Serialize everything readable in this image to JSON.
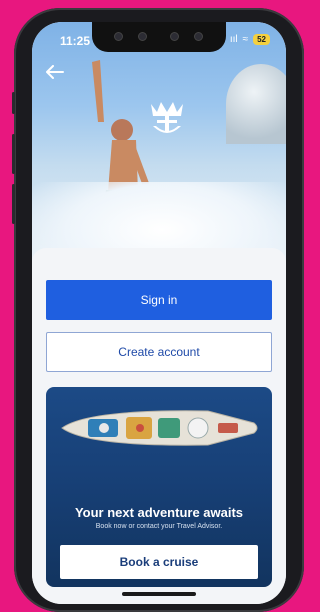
{
  "status_bar": {
    "time": "11:25",
    "signal": "ııl",
    "wifi": "≈",
    "battery": "52"
  },
  "icons": {
    "back": "back-arrow-icon",
    "logo": "royal-caribbean-crown-anchor-logo"
  },
  "auth": {
    "sign_in_label": "Sign in",
    "create_account_label": "Create account"
  },
  "promo": {
    "title": "Your next adventure awaits",
    "subtitle": "Book now or contact your Travel Advisor.",
    "cta_label": "Book a cruise"
  },
  "colors": {
    "primary": "#1f5fe0",
    "promo_bg": "#173f75",
    "background": "#e8177f"
  }
}
